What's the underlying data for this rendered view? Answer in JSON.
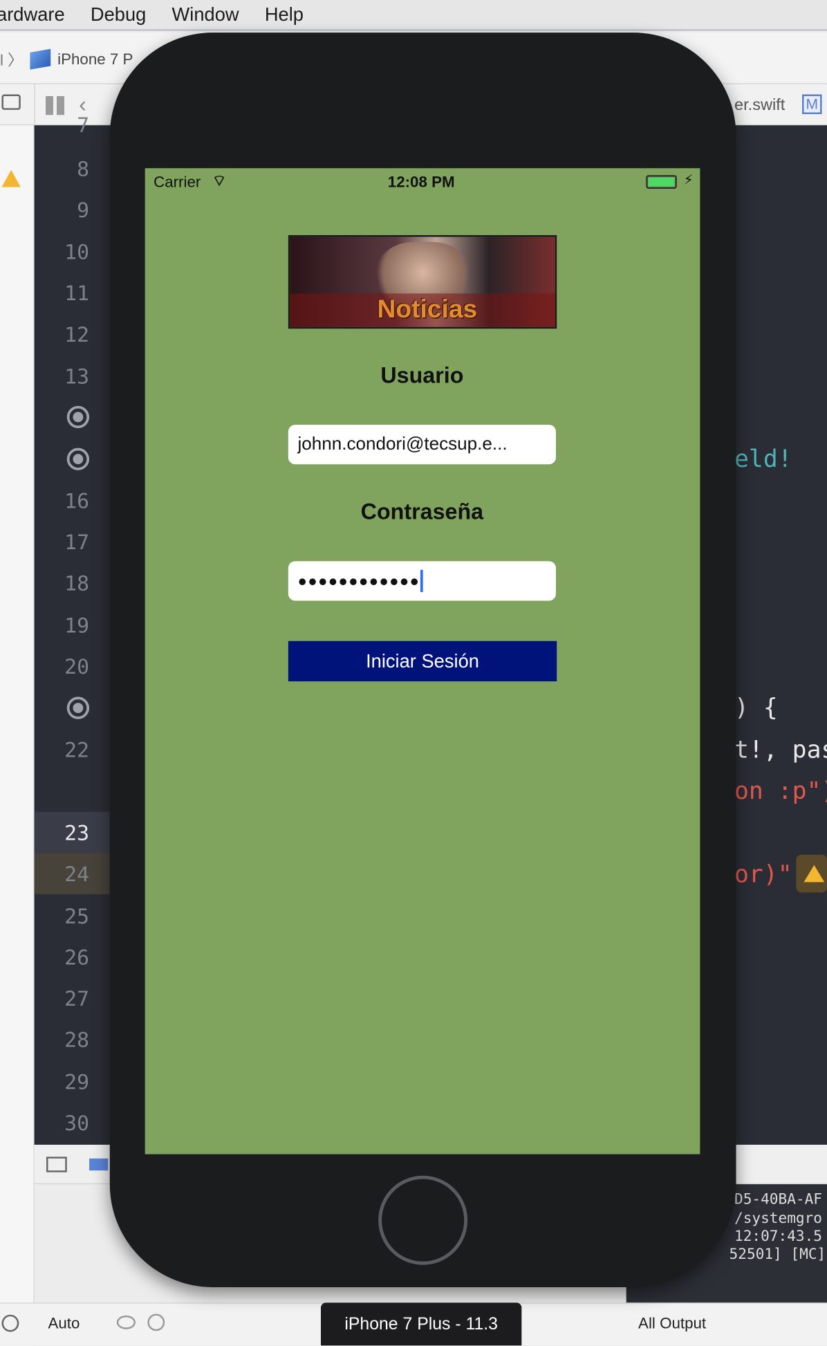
{
  "menu": [
    "ardware",
    "Debug",
    "Window",
    "Help"
  ],
  "toolbar": {
    "scheme_device": "iPhone 7 P",
    "file_crumb": "er.swift",
    "file_badge": "M"
  },
  "gutter": {
    "lines": [
      {
        "n": "7"
      },
      {
        "n": "8"
      },
      {
        "n": "9"
      },
      {
        "n": "10"
      },
      {
        "n": "11"
      },
      {
        "n": "12"
      },
      {
        "n": "13"
      },
      {
        "n": "16"
      },
      {
        "n": "17"
      },
      {
        "n": "18"
      },
      {
        "n": "19"
      },
      {
        "n": "20"
      },
      {
        "n": "22"
      },
      {
        "n": "23"
      },
      {
        "n": "24"
      },
      {
        "n": "25"
      },
      {
        "n": "26"
      },
      {
        "n": "27"
      },
      {
        "n": "28"
      },
      {
        "n": "29"
      },
      {
        "n": "30"
      }
    ]
  },
  "code_fragments": {
    "f1": "eld!",
    "f2": ") {",
    "f3": "t!, passw",
    "f4": "on :p\")",
    "f5": "or)\")"
  },
  "console_lines": [
    "D5-40BA-AF",
    "/systemgro",
    "12:07:43.5",
    "52501] [MC]"
  ],
  "bottom": {
    "auto_label": "Auto",
    "output_label": "All Output",
    "sim_label": "iPhone 7 Plus - 11.3"
  },
  "phone": {
    "status": {
      "carrier": "Carrier",
      "time": "12:08 PM"
    },
    "banner_text": "Noticias",
    "usuario_label": "Usuario",
    "email_value": "johnn.condori@tecsup.e...",
    "password_label": "Contraseña",
    "password_value": "●●●●●●●●●●●●",
    "login_button": "Iniciar Sesión"
  }
}
